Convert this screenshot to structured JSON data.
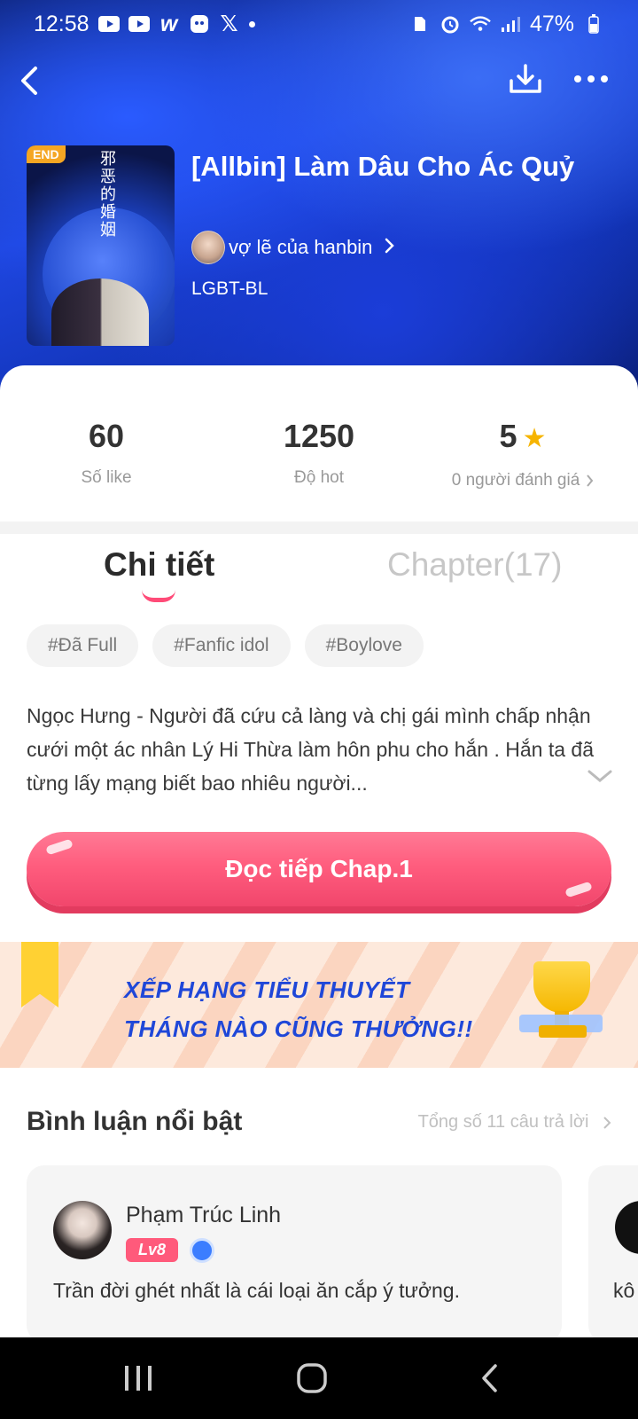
{
  "status_bar": {
    "time": "12:58",
    "battery": "47%",
    "icons_left": [
      "youtube-icon",
      "youtube-icon",
      "wattpad-icon",
      "app-icon",
      "x-icon",
      "dot-icon"
    ],
    "icons_right": [
      "sim-icon",
      "alarm-icon",
      "wifi-icon",
      "signal-icon",
      "battery-icon"
    ]
  },
  "header": {
    "back_icon": "chevron-left-icon",
    "download_icon": "download-icon",
    "more_icon": "more-dots-icon"
  },
  "book": {
    "end_badge": "END",
    "title": "[Allbin] Làm Dâu Cho Ác Quỷ",
    "author": "vợ lẽ của hanbin",
    "genre": "LGBT-BL"
  },
  "stats": [
    {
      "value": "60",
      "label": "Số like"
    },
    {
      "value": "1250",
      "label": "Độ hot"
    },
    {
      "value": "5",
      "label": "0 người đánh giá"
    }
  ],
  "tabs": [
    {
      "label": "Chi tiết",
      "active": true
    },
    {
      "label": "Chapter(17)",
      "active": false
    }
  ],
  "tags": [
    "#Đã Full",
    "#Fanfic idol",
    "#Boylove"
  ],
  "description": "Ngọc Hưng - Người đã cứu cả làng và chị gái mình chấp nhận cưới một ác nhân Lý Hi Thừa làm hôn phu cho hắn . Hắn ta đã từng lấy mạng biết bao nhiêu người...",
  "read_button": "Đọc tiếp Chap.1",
  "banner": {
    "line1": "XẾP HẠNG TIỂU THUYẾT",
    "line2": "THÁNG NÀO CŨNG THƯỞNG!!"
  },
  "comments": {
    "title": "Bình luận nổi bật",
    "total": "Tổng số 11 câu trả lời",
    "items": [
      {
        "name": "Phạm Trúc Linh",
        "level": "Lv8",
        "text": "Trần đời ghét nhất là cái loại ăn cắp ý tưởng."
      },
      {
        "text": "kô"
      }
    ]
  },
  "colors": {
    "accent": "#ff5d7e",
    "star": "#f6b400",
    "banner_text": "#1f47d8"
  }
}
